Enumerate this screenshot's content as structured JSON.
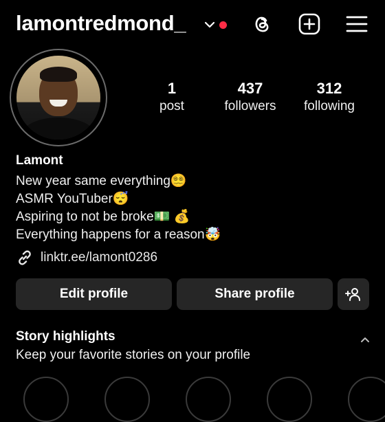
{
  "header": {
    "username": "lamontredmond_",
    "icons": [
      "chevron-down-icon",
      "notification-dot",
      "threads-icon",
      "new-post-icon",
      "menu-icon"
    ]
  },
  "profile": {
    "stats": [
      {
        "value": "1",
        "label": "post"
      },
      {
        "value": "437",
        "label": "followers"
      },
      {
        "value": "312",
        "label": "following"
      }
    ],
    "name": "Lamont",
    "bio": [
      "New year same everything😵‍💫",
      "ASMR YouTuber😴",
      "Aspiring to not be broke💵 💰",
      "Everything happens for a reason🤯"
    ],
    "link": "linktr.ee/lamont0286"
  },
  "actions": {
    "edit_label": "Edit profile",
    "share_label": "Share profile"
  },
  "highlights": {
    "title": "Story highlights",
    "subtitle": "Keep your favorite stories on your profile"
  },
  "colors": {
    "background": "#000000",
    "button_bg": "#262626",
    "notification_dot": "#ff2d46"
  }
}
